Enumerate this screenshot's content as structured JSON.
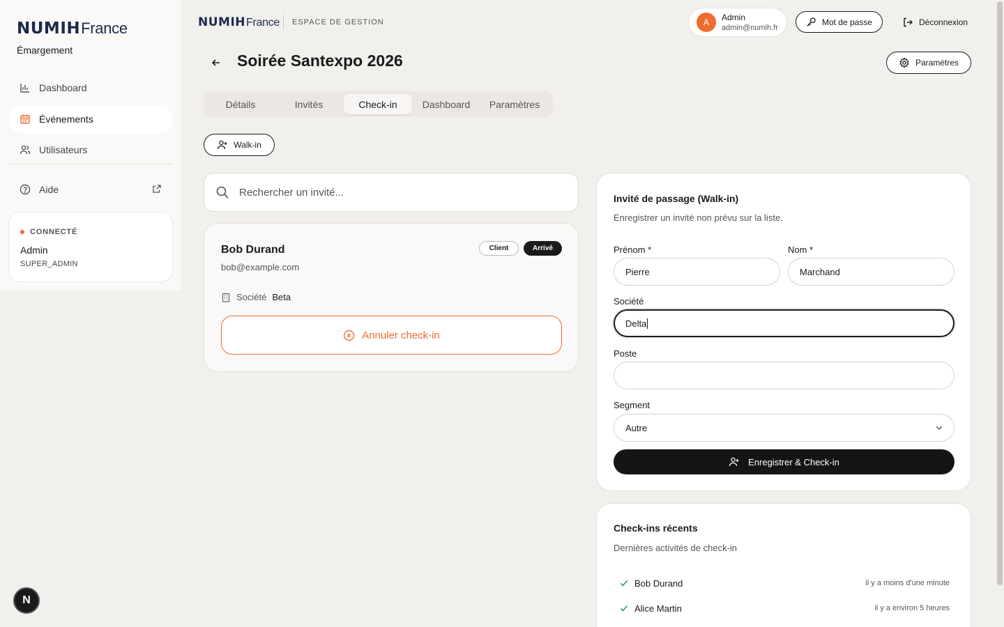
{
  "brand": {
    "numih": "NUMIH",
    "france": "France",
    "subtitle": "Émargement"
  },
  "sidebar": {
    "items": [
      {
        "label": "Dashboard",
        "icon": "bar-chart-icon"
      },
      {
        "label": "Événements",
        "icon": "calendar-icon"
      },
      {
        "label": "Utilisateurs",
        "icon": "users-icon"
      },
      {
        "label": "Aide",
        "icon": "help-circle-icon"
      }
    ],
    "status": {
      "label": "CONNECTÉ",
      "name": "Admin",
      "role": "SUPER_ADMIN"
    },
    "fab_letter": "N"
  },
  "topbar": {
    "label": "ESPACE DE GESTION",
    "user": {
      "initial": "A",
      "name": "Admin",
      "email": "admin@numih.fr"
    },
    "password_button": "Mot de passe",
    "logout_button": "Déconnexion"
  },
  "page": {
    "title": "Soirée Santexpo 2026",
    "settings_button": "Paramètres",
    "tabs": [
      "Détails",
      "Invités",
      "Check-in",
      "Dashboard",
      "Paramètres"
    ],
    "active_tab": "Check-in",
    "walkin_button": "Walk-in"
  },
  "search": {
    "placeholder": "Rechercher un invité..."
  },
  "guest": {
    "name": "Bob Durand",
    "email": "bob@example.com",
    "badges": [
      "Client",
      "Arrivé"
    ],
    "company_label": "Société",
    "company_value": "Beta",
    "cancel_button": "Annuler check-in"
  },
  "walkin_form": {
    "title": "Invité de passage (Walk-in)",
    "subtitle": "Enregistrer un invité non prévu sur la liste.",
    "first_name_label": "Prénom *",
    "first_name_value": "Pierre",
    "last_name_label": "Nom *",
    "last_name_value": "Marchand",
    "company_label": "Société",
    "company_value": "Delta",
    "position_label": "Poste",
    "position_value": "",
    "segment_label": "Segment",
    "segment_value": "Autre",
    "submit_button": "Enregistrer & Check-in"
  },
  "recent": {
    "title": "Check-ins récents",
    "subtitle": "Dernières activités de check-in",
    "items": [
      {
        "name": "Bob Durand",
        "time": "il y a moins d'une minute"
      },
      {
        "name": "Alice Martin",
        "time": "il y a environ 5 heures"
      }
    ]
  },
  "colors": {
    "accent": "#ef6c2f",
    "brand_navy": "#1d2a4d",
    "primary": "#151515",
    "background": "#f2f0ed"
  }
}
